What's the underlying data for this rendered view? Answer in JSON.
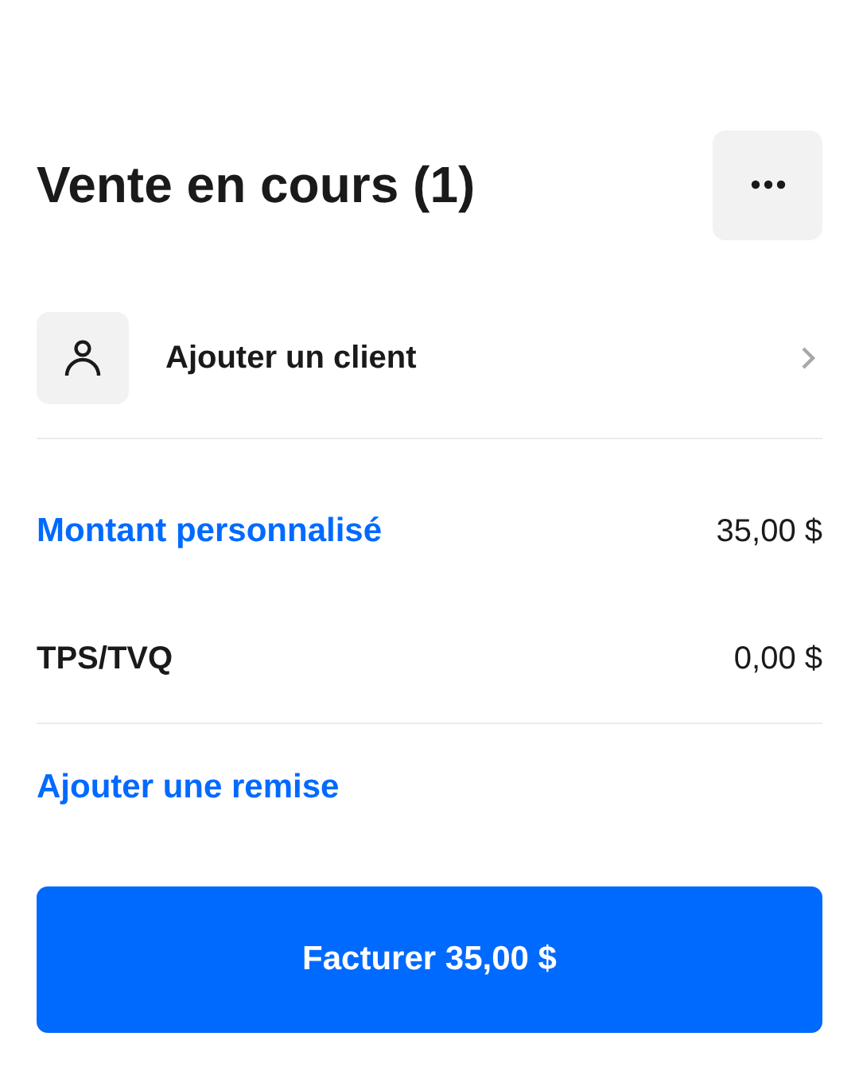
{
  "header": {
    "title": "Vente en cours (1)"
  },
  "customer": {
    "label": "Ajouter un client"
  },
  "lines": [
    {
      "kind": "link",
      "label": "Montant personnalisé",
      "amount": "35,00 $"
    },
    {
      "kind": "plain",
      "label": "TPS/TVQ",
      "amount": "0,00 $"
    }
  ],
  "discount": {
    "label": "Ajouter une remise"
  },
  "charge_button": {
    "label": "Facturer 35,00 $"
  }
}
